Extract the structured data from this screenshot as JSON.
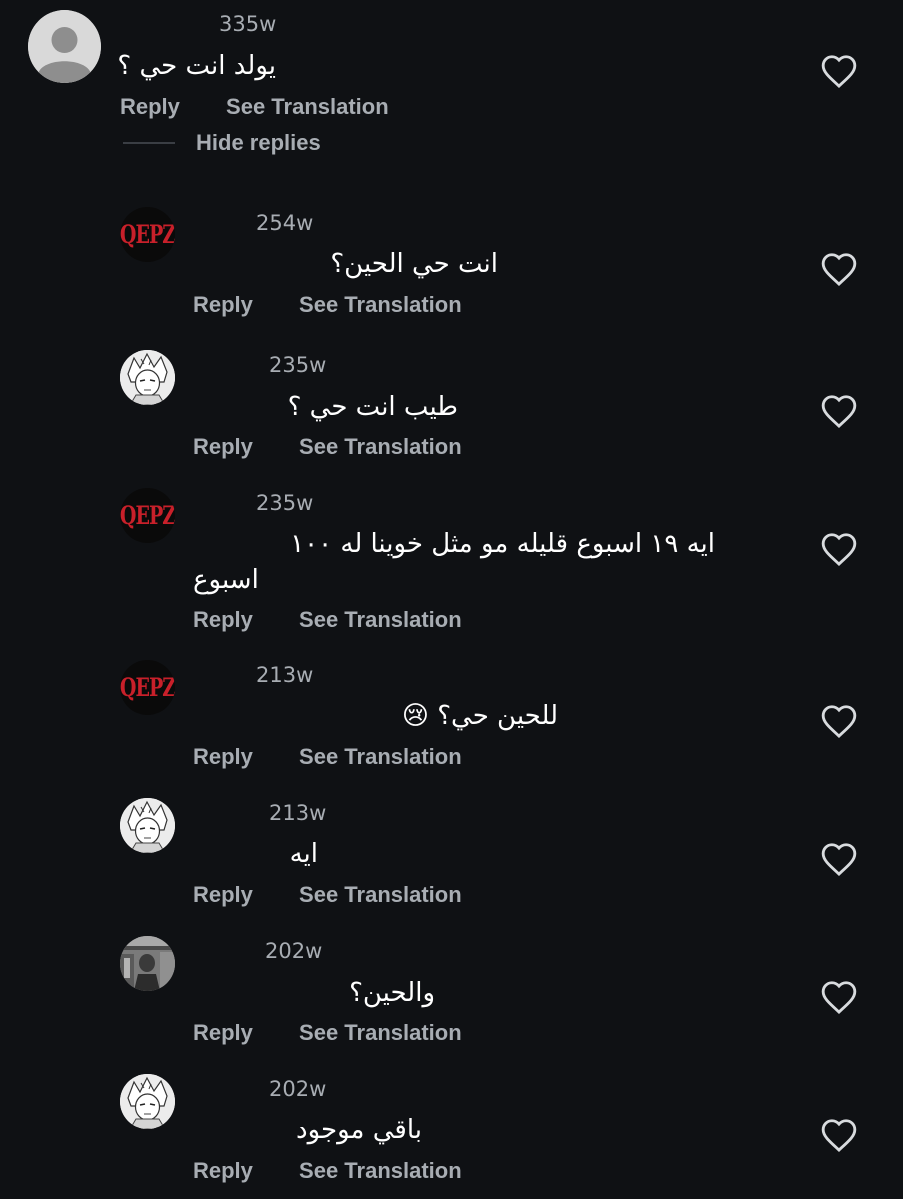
{
  "labels": {
    "reply": "Reply",
    "see_translation": "See Translation",
    "hide_replies": "Hide replies"
  },
  "parent": {
    "timestamp": "335w",
    "text": "يولد انت حي ؟",
    "avatar": "default-user-avatar"
  },
  "replies": [
    {
      "timestamp": "254w",
      "text": "انت حي الحين؟",
      "avatar": "QEPZ"
    },
    {
      "timestamp": "235w",
      "text": "طيب انت حي ؟",
      "avatar": "anime-avatar"
    },
    {
      "timestamp": "235w",
      "text_line1": "ايه ١٩ اسبوع قليله مو مثل خوينا له ١٠٠",
      "text_line2": "اسبوع",
      "avatar": "QEPZ"
    },
    {
      "timestamp": "213w",
      "text": "للحين حي؟ 😢",
      "avatar": "QEPZ"
    },
    {
      "timestamp": "213w",
      "text": "ايه",
      "avatar": "anime-avatar"
    },
    {
      "timestamp": "202w",
      "text": "والحين؟",
      "avatar": "photo-avatar"
    },
    {
      "timestamp": "202w",
      "text": "باقي موجود",
      "avatar": "anime-avatar"
    }
  ],
  "colors": {
    "background": "#0f1114",
    "secondary_text": "#a8adb3",
    "qepz_red": "#c8202a"
  },
  "icons": {
    "like": "heart-outline-icon"
  }
}
